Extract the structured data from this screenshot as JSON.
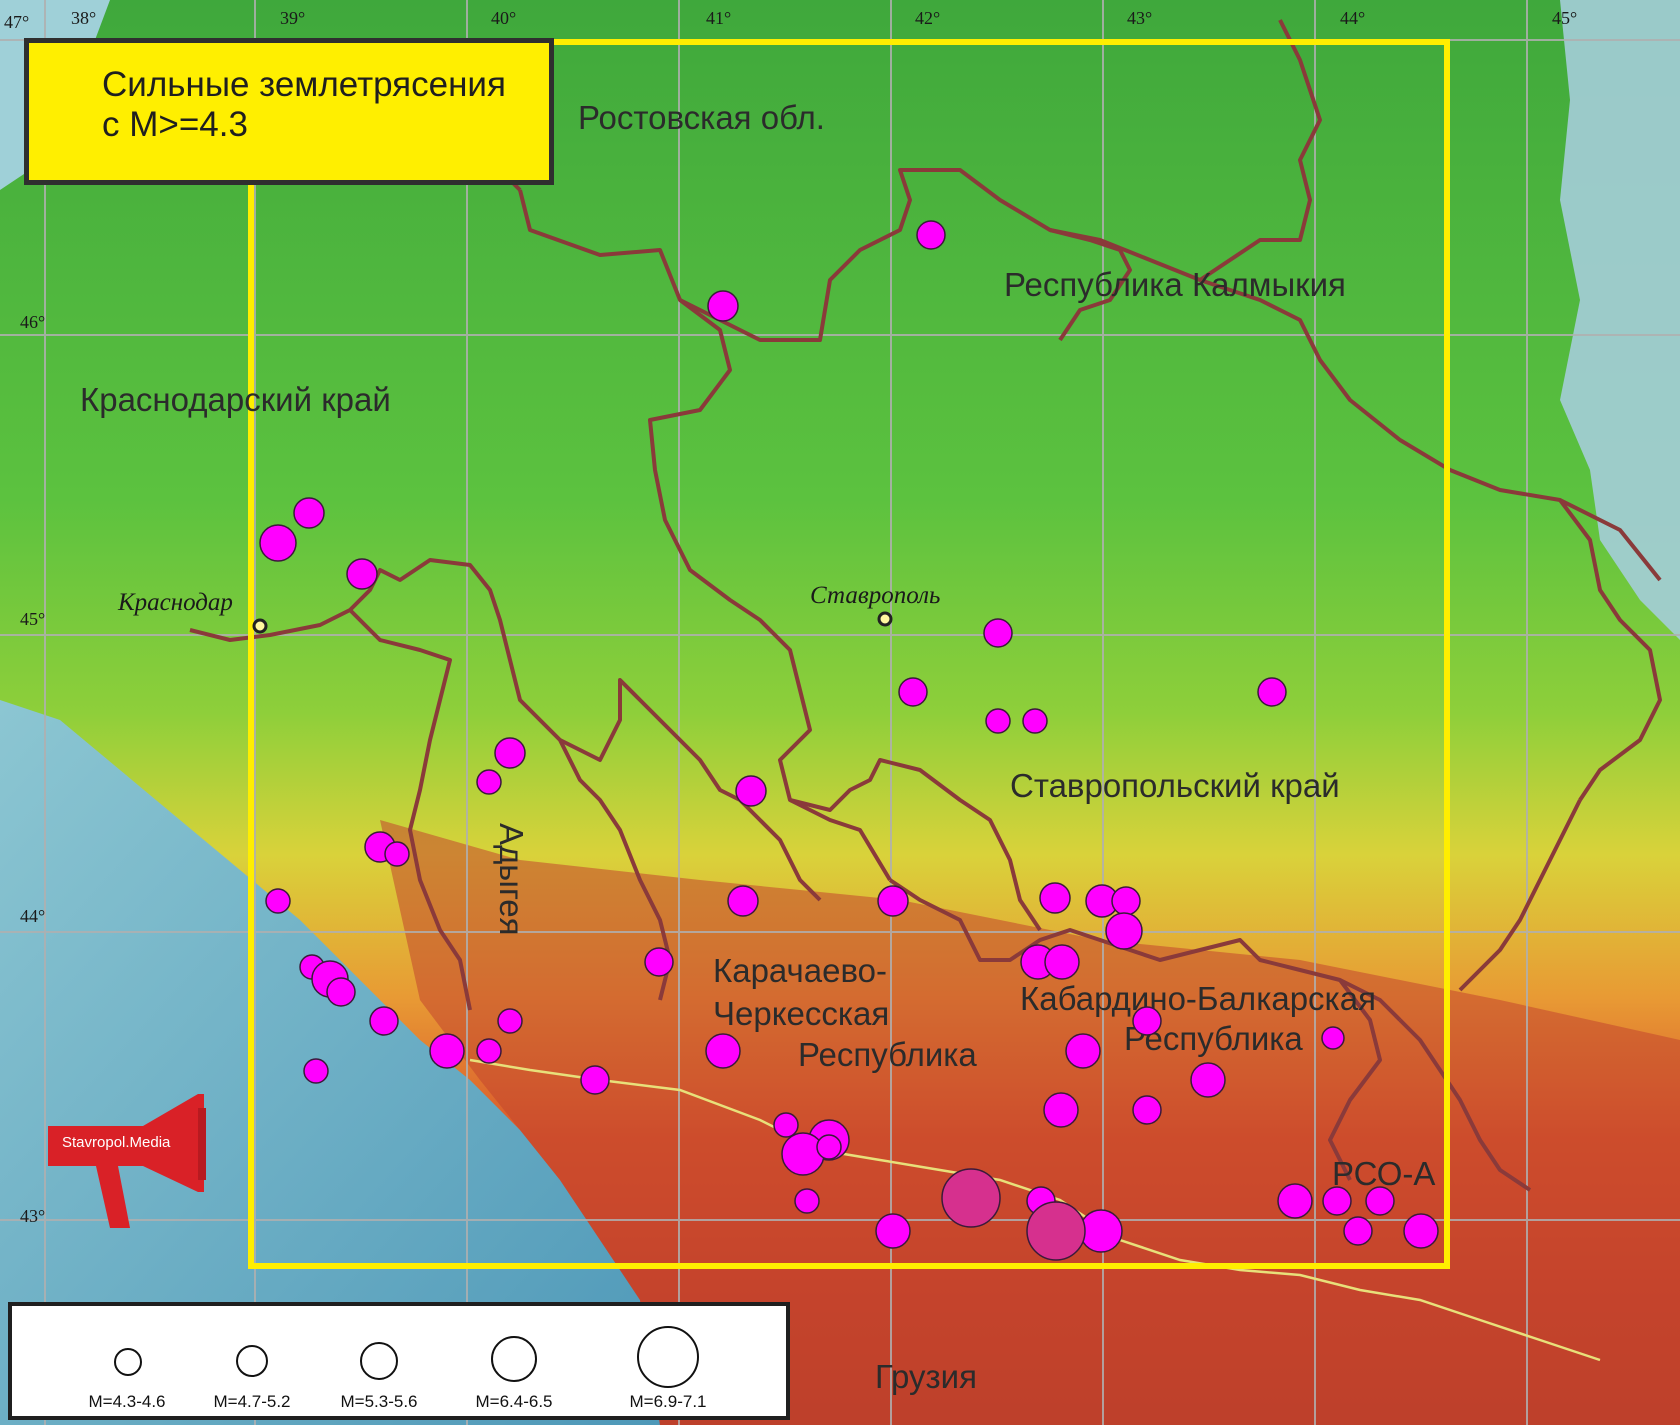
{
  "map": {
    "title": "Сильные землетрясения\nс M>=4.3",
    "longitude_labels": [
      "38°",
      "39°",
      "40°",
      "41°",
      "42°",
      "43°",
      "44°",
      "45°"
    ],
    "latitude_labels": [
      "47°",
      "46°",
      "45°",
      "44°",
      "43°"
    ],
    "regions": {
      "rostov": "Ростовская обл.",
      "kalmykia": "Республика Калмыкия",
      "krasnodar": "Краснодарский край",
      "stavropol": "Ставропольский край",
      "adygea": "Адыгея",
      "kchr_1": "Карачаево-",
      "kchr_2": "Черкесская",
      "kchr_3": "Республика",
      "kbr_1": "Кабардино-Балкарская",
      "kbr_2": "Республика",
      "rso": "РСО-А",
      "georgia": "Грузия"
    },
    "cities": {
      "krasnodar": "Краснодар",
      "stavropol": "Ставрополь"
    },
    "colors": {
      "epicenter": "#ff00ff",
      "epicenter_strong": "#d6308e",
      "study_area": "#ffee00",
      "admin_border": "#8a3a3a"
    }
  },
  "legend": {
    "items": [
      {
        "label": "M=4.3-4.6"
      },
      {
        "label": "M=4.7-5.2"
      },
      {
        "label": "M=5.3-5.6"
      },
      {
        "label": "M=6.4-6.5"
      },
      {
        "label": "M=6.9-7.1"
      }
    ]
  },
  "brand": {
    "name": "Stavropol.Media"
  }
}
